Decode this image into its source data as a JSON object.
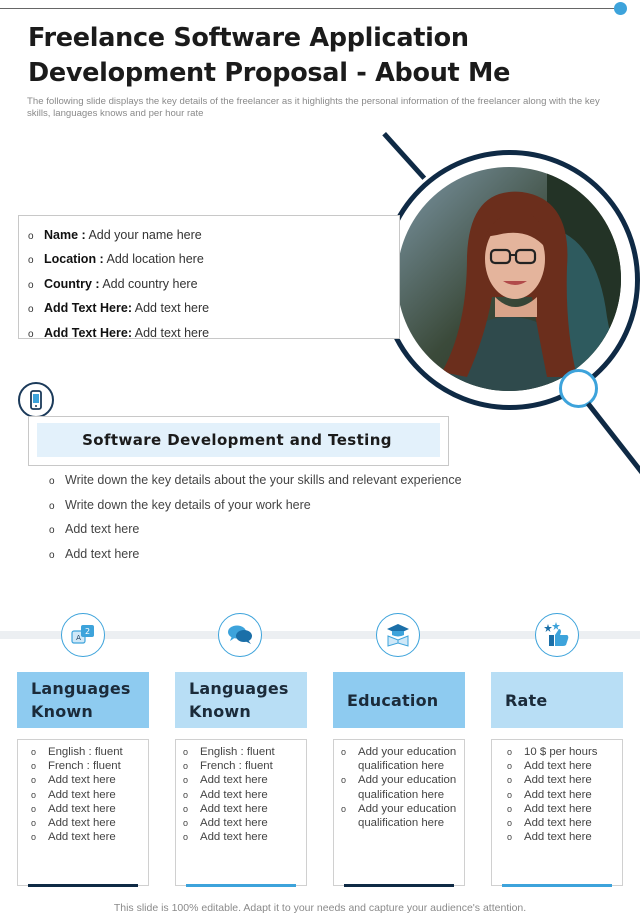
{
  "title": "Freelance Software Application Development Proposal - About Me",
  "subtitle": "The following slide displays the key details of the freelancer as it highlights the  personal information of the freelancer along with the key skills, languages knows and per hour rate",
  "profile": {
    "items": [
      {
        "label": "Name :",
        "value": " Add your name here"
      },
      {
        "label": "Location :",
        "value": " Add location here"
      },
      {
        "label": "Country :",
        "value": " Add country here"
      },
      {
        "label": "Add  Text Here:",
        "value": " Add text here"
      },
      {
        "label": "Add  Text Here:",
        "value": " Add text here"
      }
    ]
  },
  "section": {
    "title": "Software Development and Testing",
    "items": [
      "Write down the key details about the your skills and relevant experience",
      "Write down the key details of your work here",
      "Add text here",
      "Add text here"
    ]
  },
  "cards": [
    {
      "title_line1": "Languages",
      "title_line2": "Known",
      "icon": "translate-icon",
      "head_color": "#8ecbf0",
      "bar_color": "#0f2a45",
      "items": [
        "English : fluent",
        "French : fluent",
        "Add text here",
        "Add text here",
        "Add text here",
        "Add text here",
        "Add text here"
      ]
    },
    {
      "title_line1": "Languages",
      "title_line2": "Known",
      "icon": "chat-bubbles-icon",
      "head_color": "#b8def5",
      "bar_color": "#3da3db",
      "items": [
        "English : fluent",
        "French : fluent",
        "Add text here",
        "Add text here",
        "Add text here",
        "Add text here",
        "Add text here"
      ]
    },
    {
      "title_line1": "Education",
      "title_line2": "",
      "icon": "graduation-book-icon",
      "head_color": "#8ecbf0",
      "bar_color": "#0f2a45",
      "items": [
        "Add your education qualification  here",
        "Add your education qualification  here",
        "Add your education qualification  here"
      ]
    },
    {
      "title_line1": "Rate",
      "title_line2": "",
      "icon": "thumbs-up-stars-icon",
      "head_color": "#b8def5",
      "bar_color": "#3da3db",
      "items": [
        "10 $ per hours",
        "Add text here",
        "Add text here",
        "Add text here",
        "Add text here",
        "Add text here",
        "Add text here"
      ]
    }
  ],
  "bullet_glyph": "o",
  "footer": "This slide is 100% editable. Adapt it to your needs and capture your audience's attention.",
  "colors": {
    "accent": "#3da3db",
    "navy": "#0f2a45",
    "light_fill": "#e3f1fb"
  }
}
